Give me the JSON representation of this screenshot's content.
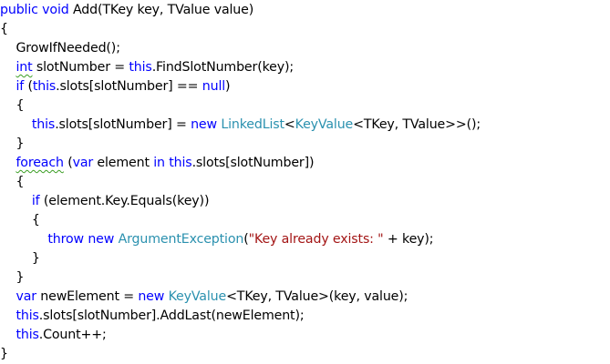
{
  "editor": {
    "colors": {
      "keyword": "#0000ff",
      "type": "#2b91af",
      "string": "#a31515",
      "plain": "#000000",
      "squiggle": "#3a9d23",
      "background": "#ffffff"
    },
    "lines": [
      [
        {
          "t": "public",
          "c": "kw"
        },
        {
          "t": " "
        },
        {
          "t": "void",
          "c": "kw"
        },
        {
          "t": " Add(TKey key, TValue value)"
        }
      ],
      [
        {
          "t": "{"
        }
      ],
      [
        {
          "t": "    GrowIfNeeded();"
        }
      ],
      [
        {
          "t": "    "
        },
        {
          "t": "int",
          "c": "kw",
          "squiggle": true
        },
        {
          "t": " slotNumber = "
        },
        {
          "t": "this",
          "c": "kw"
        },
        {
          "t": ".FindSlotNumber(key);"
        }
      ],
      [
        {
          "t": "    "
        },
        {
          "t": "if",
          "c": "kw"
        },
        {
          "t": " ("
        },
        {
          "t": "this",
          "c": "kw"
        },
        {
          "t": ".slots[slotNumber] == "
        },
        {
          "t": "null",
          "c": "kw"
        },
        {
          "t": ")"
        }
      ],
      [
        {
          "t": "    {"
        }
      ],
      [
        {
          "t": "        "
        },
        {
          "t": "this",
          "c": "kw"
        },
        {
          "t": ".slots[slotNumber] = "
        },
        {
          "t": "new",
          "c": "kw"
        },
        {
          "t": " "
        },
        {
          "t": "LinkedList",
          "c": "type"
        },
        {
          "t": "<"
        },
        {
          "t": "KeyValue",
          "c": "type"
        },
        {
          "t": "<TKey, TValue>>();"
        }
      ],
      [
        {
          "t": "    }"
        }
      ],
      [
        {
          "t": "    "
        },
        {
          "t": "foreach",
          "c": "kw",
          "squiggle": true
        },
        {
          "t": " ("
        },
        {
          "t": "var",
          "c": "kw"
        },
        {
          "t": " element "
        },
        {
          "t": "in",
          "c": "kw"
        },
        {
          "t": " "
        },
        {
          "t": "this",
          "c": "kw"
        },
        {
          "t": ".slots[slotNumber])"
        }
      ],
      [
        {
          "t": "    {"
        }
      ],
      [
        {
          "t": "        "
        },
        {
          "t": "if",
          "c": "kw"
        },
        {
          "t": " (element.Key.Equals(key))"
        }
      ],
      [
        {
          "t": "        {"
        }
      ],
      [
        {
          "t": "            "
        },
        {
          "t": "throw",
          "c": "kw"
        },
        {
          "t": " "
        },
        {
          "t": "new",
          "c": "kw"
        },
        {
          "t": " "
        },
        {
          "t": "ArgumentException",
          "c": "type"
        },
        {
          "t": "("
        },
        {
          "t": "\"Key already exists: \"",
          "c": "str"
        },
        {
          "t": " + key);"
        }
      ],
      [
        {
          "t": "        }"
        }
      ],
      [
        {
          "t": "    }"
        }
      ],
      [
        {
          "t": "    "
        },
        {
          "t": "var",
          "c": "kw"
        },
        {
          "t": " newElement = "
        },
        {
          "t": "new",
          "c": "kw"
        },
        {
          "t": " "
        },
        {
          "t": "KeyValue",
          "c": "type"
        },
        {
          "t": "<TKey, TValue>(key, value);"
        }
      ],
      [
        {
          "t": "    "
        },
        {
          "t": "this",
          "c": "kw"
        },
        {
          "t": ".slots[slotNumber].AddLast(newElement);"
        }
      ],
      [
        {
          "t": "    "
        },
        {
          "t": "this",
          "c": "kw"
        },
        {
          "t": ".Count++;"
        }
      ],
      [
        {
          "t": "}"
        }
      ]
    ]
  }
}
